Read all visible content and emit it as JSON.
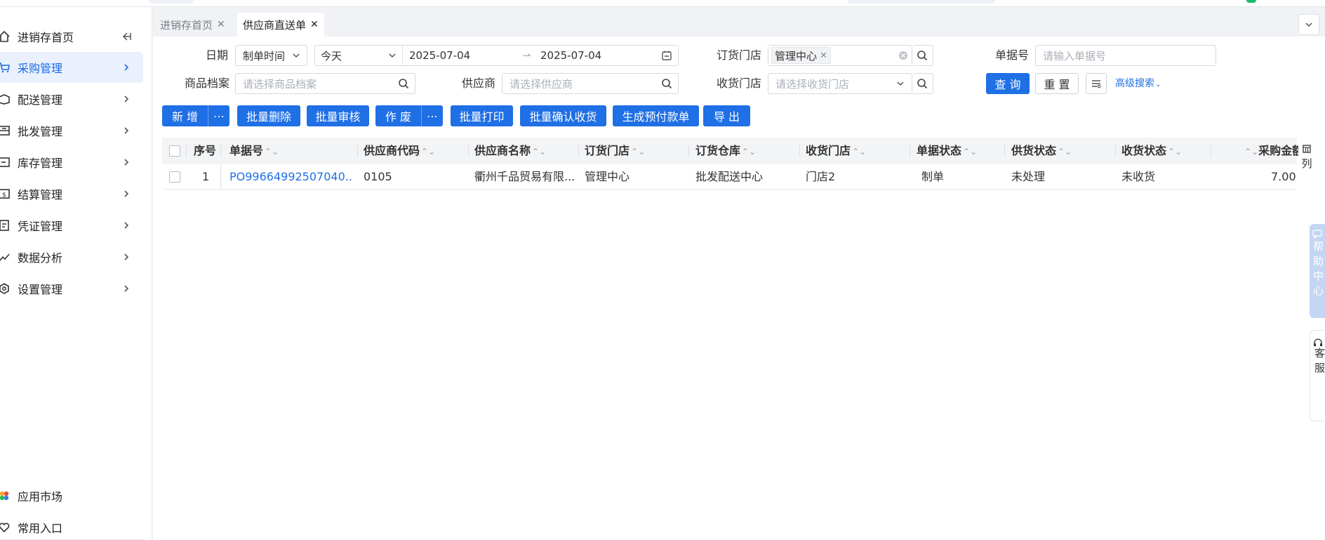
{
  "sidebar": {
    "items": [
      {
        "label": "进销存首页",
        "icon": "home-icon"
      },
      {
        "label": "采购管理",
        "icon": "cart-icon",
        "active": true
      },
      {
        "label": "配送管理",
        "icon": "delivery-icon"
      },
      {
        "label": "批发管理",
        "icon": "wholesale-icon"
      },
      {
        "label": "库存管理",
        "icon": "inventory-icon"
      },
      {
        "label": "结算管理",
        "icon": "settlement-icon"
      },
      {
        "label": "凭证管理",
        "icon": "voucher-icon"
      },
      {
        "label": "数据分析",
        "icon": "chart-icon"
      },
      {
        "label": "设置管理",
        "icon": "settings-icon"
      }
    ],
    "bottom": [
      {
        "label": "应用市场",
        "icon": "app-market-icon"
      },
      {
        "label": "常用入口",
        "icon": "heart-icon"
      }
    ]
  },
  "tabs": [
    {
      "label": "进销存首页",
      "active": false
    },
    {
      "label": "供应商直送单",
      "active": true
    }
  ],
  "filters": {
    "date_label": "日期",
    "date_type": "制单时间",
    "date_range": "今天",
    "date_start": "2025-07-04",
    "date_end": "2025-07-04",
    "order_store_label": "订货门店",
    "order_store_tag": "管理中心",
    "order_no_label": "单据号",
    "order_no_placeholder": "请输入单据号",
    "product_label": "商品档案",
    "product_placeholder": "请选择商品档案",
    "supplier_label": "供应商",
    "supplier_placeholder": "请选择供应商",
    "receive_store_label": "收货门店",
    "receive_store_placeholder": "请选择收货门店",
    "query_btn": "查 询",
    "reset_btn": "重 置",
    "advanced_link": "高级搜索"
  },
  "toolbar": {
    "add": "新 增",
    "more": "⋯",
    "batch_delete": "批量删除",
    "batch_audit": "批量审核",
    "void": "作 废",
    "batch_print": "批量打印",
    "batch_confirm": "批量确认收货",
    "gen_prepay": "生成预付款单",
    "export": "导 出"
  },
  "table": {
    "columns": [
      "序号",
      "单据号",
      "供应商代码",
      "供应商名称",
      "订货门店",
      "订货仓库",
      "收货门店",
      "单据状态",
      "供货状态",
      "收货状态",
      "采购金额"
    ],
    "rows": [
      [
        "1",
        "PO99664992507040...",
        "0105",
        "衢州千品贸易有限...",
        "管理中心",
        "批发配送中心",
        "门店2",
        "制单",
        "未处理",
        "未收货",
        "7.00"
      ]
    ]
  },
  "right_rail": {
    "columns_btn": "列",
    "help": "帮助中心",
    "service": "客服"
  },
  "colors": {
    "primary": "#1f6fe5",
    "active_bg": "#eaf1fd"
  }
}
